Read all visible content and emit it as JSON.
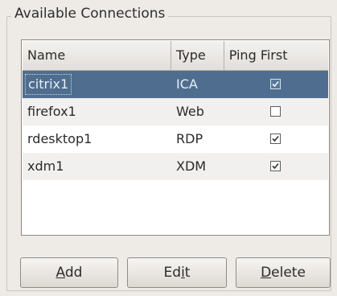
{
  "group": {
    "title": "Available Connections"
  },
  "table": {
    "columns": [
      "Name",
      "Type",
      "Ping First"
    ],
    "rows": [
      {
        "name": "citrix1",
        "type": "ICA",
        "ping_first": true,
        "selected": true
      },
      {
        "name": "firefox1",
        "type": "Web",
        "ping_first": false,
        "selected": false
      },
      {
        "name": "rdesktop1",
        "type": "RDP",
        "ping_first": true,
        "selected": false
      },
      {
        "name": "xdm1",
        "type": "XDM",
        "ping_first": true,
        "selected": false
      }
    ]
  },
  "buttons": {
    "add": {
      "mnemonic": "A",
      "rest": "dd"
    },
    "edit": {
      "pre": "Ed",
      "mnemonic": "i",
      "rest": "t"
    },
    "delete": {
      "mnemonic": "D",
      "rest": "elete"
    }
  },
  "colors": {
    "selection": "#4f6e8f",
    "window_bg": "#eeebe7"
  }
}
